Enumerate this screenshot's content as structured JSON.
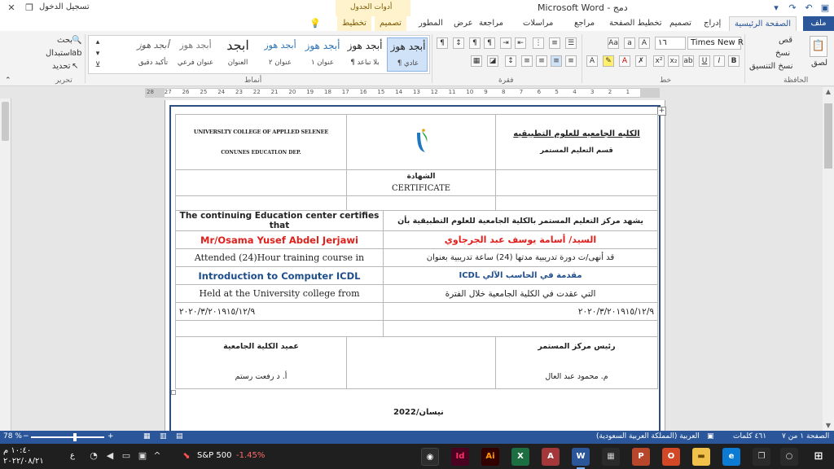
{
  "titlebar": {
    "app_title": "Microsoft Word - دمج",
    "context_group": "أدوات الجدول",
    "signin": "تسجيل الدخول"
  },
  "tabs": {
    "file": "ملف",
    "home": "الصفحة الرئيسية",
    "insert": "إدراج",
    "design": "تصميم",
    "layout": "تخطيط الصفحة",
    "references": "مراجع",
    "mailings": "مراسلات",
    "review": "مراجعة",
    "view": "عرض",
    "developer": "المطور",
    "table_design": "تصميم",
    "table_layout": "تخطيط"
  },
  "ribbon": {
    "clipboard": {
      "label": "الحافظة",
      "paste": "لصق",
      "cut": "قص",
      "copy": "نسخ",
      "format_painter": "نسخ التنسيق"
    },
    "font": {
      "label": "خط",
      "font_name": "Times New R",
      "font_size": "١٦",
      "bold": "B",
      "italic": "I",
      "underline": "U"
    },
    "paragraph": {
      "label": "فقرة"
    },
    "styles": {
      "label": "أنماط",
      "items": [
        {
          "preview": "أبجد هوز",
          "name": "¶ عادي"
        },
        {
          "preview": "أبجد هوز",
          "name": "¶ بلا تباعد"
        },
        {
          "preview": "أبجد هوز",
          "name": "عنوان ١"
        },
        {
          "preview": "أبجد هوز",
          "name": "عنوان ٢"
        },
        {
          "preview": "ابجد",
          "name": "العنوان"
        },
        {
          "preview": "أبجد هوز",
          "name": "عنوان فرعي"
        },
        {
          "preview": "أبجد هوز",
          "name": "تأكيد دقيق"
        }
      ]
    },
    "editing": {
      "label": "تحرير",
      "find": "بحث",
      "replace": "استبدال",
      "select": "تحديد"
    }
  },
  "ruler": {
    "ticks": [
      "28",
      "27",
      "26",
      "25",
      "24",
      "23",
      "22",
      "21",
      "20",
      "19",
      "18",
      "17",
      "16",
      "15",
      "14",
      "13",
      "12",
      "11",
      "10",
      "9",
      "8",
      "7",
      "6",
      "5",
      "4",
      "3",
      "2",
      "1"
    ]
  },
  "document": {
    "header_en_line1": "UNIVERSLTY COLLEGE OF APPLLED SELENEE",
    "header_en_line2": "CONUNES EDUCATLON DEP.",
    "header_ar_line1": "الكليه الجامعيه  للعلوم التطبيقيه",
    "header_ar_line2": "قسم التعليم المستمر",
    "cert_title_ar": "الشهادة",
    "cert_title_en": "CERTIFICATE",
    "certifies_en": "The continuing Education center certifies that",
    "certifies_ar": "يشهد مركز التعليم المستمر بالكلية الجامعية للعلوم التطبيقية بأن",
    "name_en": "Mr/Osama Yusef Abdel Jerjawi",
    "name_ar": "السيد/ أسامة يوسف عبد الجرجاوي",
    "attended_en": "Attended (24)Hour training course in",
    "attended_ar": "قد أنهى/ت دورة تدريبية مدتها (24) ساعة تدريبية بعنوان",
    "course_en": "Introduction to Computer ICDL",
    "course_ar": "مقدمة في الحاسب الآلي ICDL",
    "held_en": "Held at the University college from",
    "held_ar": "التي عقدت في الكلية الجامعية خلال الفترة",
    "date_range_en": "٢٠٢٠/٣/٢٠١٩١٥/١٢/٩",
    "date_range_ar": "٢٠٢٠/٣/٢٠١٩١٥/١٢/٩",
    "sign1_title": "رئيس مركز المستمر",
    "sign1_name": "م. محمود عبد العال",
    "sign2_title": "عميد الكلية الجامعية",
    "sign2_name": "أ.  د رفعت رستم",
    "issue_date": "نيسان/2022"
  },
  "statusbar": {
    "page": "الصفحة ١ من ٧",
    "words": "٤٦١ كلمات",
    "language": "العربية (المملكة العربية السعودية)",
    "zoom": "78 %"
  },
  "taskbar": {
    "stock_name": "S&P 500",
    "stock_change": "-1.45%",
    "time": "١٠:٤٠ م",
    "date": "٢٠٢٢/٠٨/٢١",
    "lang": "ع"
  },
  "colors": {
    "accent": "#2b579a",
    "red_text": "#e0201c",
    "blue_text": "#1f4e8c",
    "stock_negative": "#ff6b6b"
  }
}
